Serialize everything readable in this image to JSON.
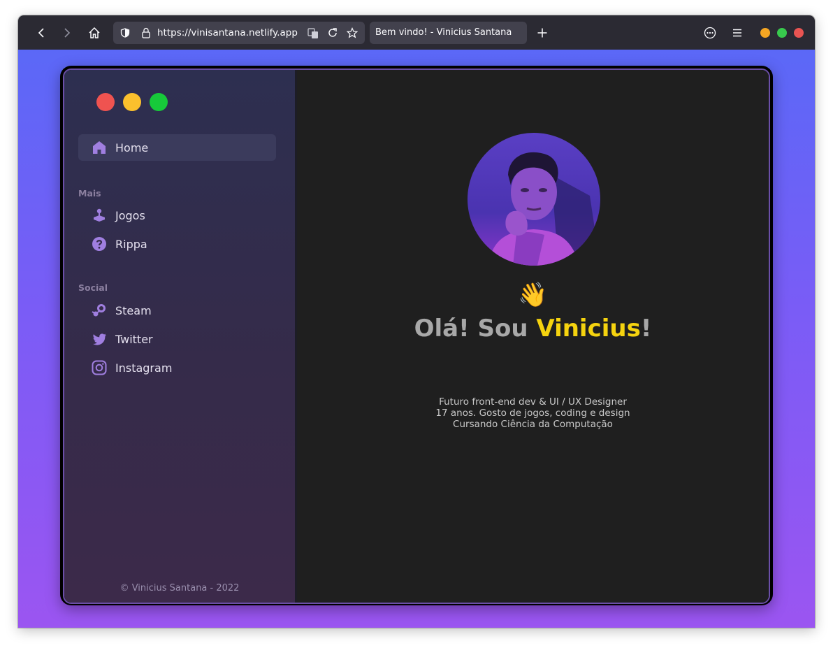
{
  "browser": {
    "url": "https://vinisantana.netlify.app",
    "tab_title": "Bem vindo! - Vinicius Santana",
    "window_controls_colors": [
      "#f5a623",
      "#38c94d",
      "#e95452"
    ]
  },
  "app": {
    "traffic_lights": [
      "#ef5350",
      "#fbc02d",
      "#17c93a"
    ],
    "nav": {
      "home_label": "Home",
      "sections": [
        {
          "label": "Mais",
          "items": [
            {
              "label": "Jogos",
              "icon": "gamepad-icon"
            },
            {
              "label": "Rippa",
              "icon": "question-icon"
            }
          ]
        },
        {
          "label": "Social",
          "items": [
            {
              "label": "Steam",
              "icon": "steam-icon"
            },
            {
              "label": "Twitter",
              "icon": "twitter-icon"
            },
            {
              "label": "Instagram",
              "icon": "instagram-icon"
            }
          ]
        }
      ]
    },
    "footer": "© Vinicius Santana - 2022",
    "accent_color": "#9b72d6"
  },
  "hero": {
    "wave_emoji": "👋",
    "greeting_prefix": "Olá! Sou ",
    "greeting_name": "Vinicius",
    "greeting_suffix": "!",
    "highlight_color": "#f5d30f",
    "bio_lines": [
      "Futuro front-end dev & UI / UX Designer",
      "17 anos. Gosto de jogos, coding e design",
      "Cursando Ciência da Computação"
    ]
  }
}
